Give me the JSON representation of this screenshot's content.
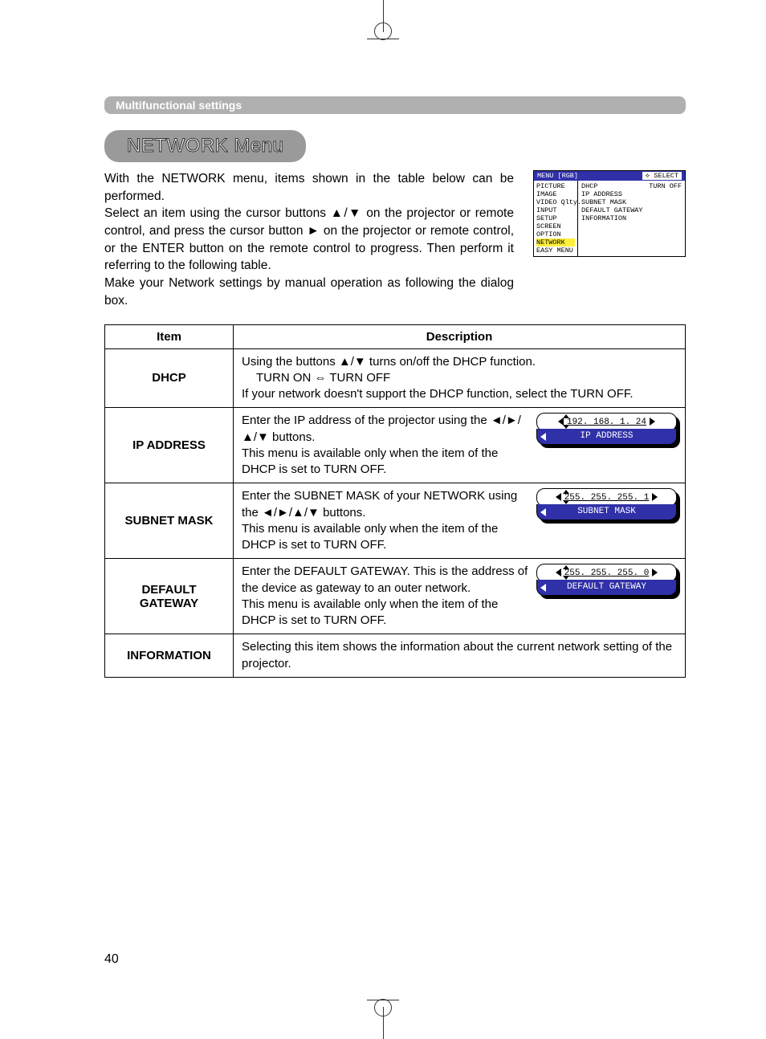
{
  "section_header": "Multifunctional settings",
  "title": "NETWORK Menu",
  "intro_p1": "With the NETWORK menu, items shown in the table below can be performed.",
  "intro_p2": "Select an item using the cursor buttons ▲/▼ on the projector or remote control, and press the cursor button ► on the projector or remote control, or the ENTER button on the remote control to progress. Then perform it referring to the following table.",
  "intro_p3": "Make your Network settings by manual operation as following the dialog box.",
  "osd": {
    "menu_label": "MENU [RGB]",
    "select_label": "SELECT",
    "left_items": [
      "PICTURE",
      "IMAGE",
      "VIDEO Qlty.",
      "INPUT",
      "SETUP",
      "SCREEN",
      "OPTION",
      "NETWORK",
      "EASY MENU"
    ],
    "highlighted_left": "NETWORK",
    "right_items": [
      {
        "label": "DHCP",
        "value": "TURN OFF"
      },
      {
        "label": "IP ADDRESS",
        "value": ""
      },
      {
        "label": "SUBNET MASK",
        "value": ""
      },
      {
        "label": "DEFAULT GATEWAY",
        "value": ""
      },
      {
        "label": "INFORMATION",
        "value": ""
      }
    ]
  },
  "table": {
    "head_item": "Item",
    "head_desc": "Description",
    "rows": [
      {
        "item": "DHCP",
        "desc_line1": "Using the buttons ▲/▼ turns on/off the DHCP function.",
        "toggle": "TURN ON ⇔ TURN OFF",
        "desc_line2": "If your network doesn't support the DHCP function, select the TURN OFF."
      },
      {
        "item": "IP ADDRESS",
        "desc_line1": "Enter the IP address of the projector  using the ◄/►/▲/▼ buttons.",
        "desc_line2": "This menu is available only when the item of the DHCP is set to TURN OFF.",
        "popup_value": "192. 168.  1.   24",
        "popup_label": "IP ADDRESS"
      },
      {
        "item": "SUBNET MASK",
        "desc_line1": "Enter the SUBNET MASK  of your NETWORK using the ◄/►/▲/▼ buttons.",
        "desc_line2": "This menu is available only when the item of the DHCP is set to TURN OFF.",
        "popup_value": "255. 255. 255.  1",
        "popup_label": "SUBNET MASK"
      },
      {
        "item": "DEFAULT GATEWAY",
        "desc_line1": "Enter the DEFAULT GATEWAY. This is the address of the device as gateway to an outer network.",
        "desc_line2": "This menu is available only when the item of the DHCP is set to TURN OFF.",
        "popup_value": "255. 255. 255.  0",
        "popup_label": "DEFAULT GATEWAY"
      },
      {
        "item": "INFORMATION",
        "desc_line1": "Selecting this item shows the information about the current network setting of the projector."
      }
    ]
  },
  "page_number": "40"
}
